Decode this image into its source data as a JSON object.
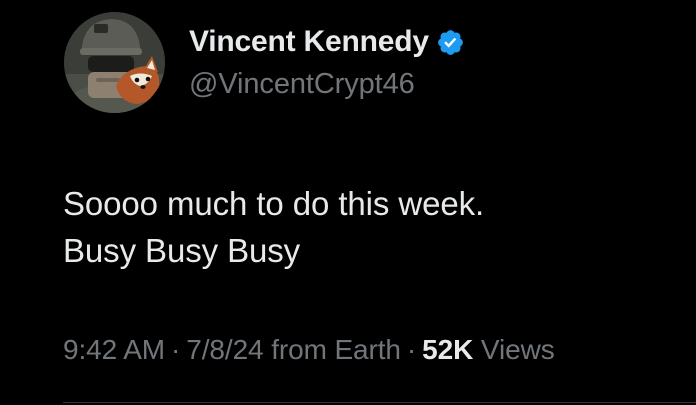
{
  "author": {
    "display_name": "Vincent Kennedy",
    "handle": "@VincentCrypt46",
    "verified_icon": "verified-badge-icon",
    "verified_color": "#1d9bf0"
  },
  "tweet": {
    "text_lines": [
      "Soooo much to do this week.",
      "Busy Busy Busy"
    ]
  },
  "meta": {
    "time": "9:42 AM",
    "separator": "·",
    "date": "7/8/24",
    "location": "from Earth",
    "views_count": "52K",
    "views_label": "Views"
  },
  "colors": {
    "background": "#000000",
    "primary_text": "#e7e9ea",
    "secondary_text": "#71767b"
  }
}
